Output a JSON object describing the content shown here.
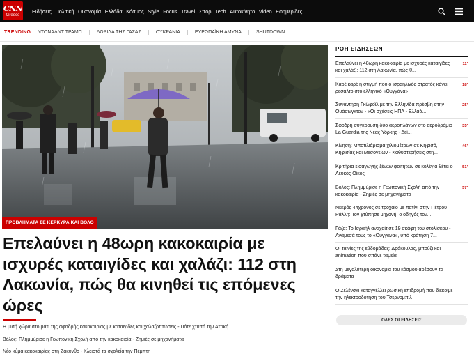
{
  "brand": {
    "logo_line1": "CNN",
    "logo_line2": "Greece",
    "accent": "#cc0000",
    "nav_bg": "#0c0c0c"
  },
  "nav": {
    "items": [
      "Ειδήσεις",
      "Πολιτική",
      "Οικονομία",
      "Ελλάδα",
      "Κόσμος",
      "Style",
      "Focus",
      "Travel",
      "Σπορ",
      "Tech",
      "Αυτοκίνητο",
      "Video",
      "Εφημερίδες"
    ],
    "icons": [
      "search-icon",
      "menu-icon"
    ]
  },
  "trending": {
    "label": "TRENDING:",
    "items": [
      "ΝΤΟΝΑΛΝΤ ΤΡΑΜΠ",
      "ΛΩΡΙΔΑ ΤΗΣ ΓΑΖΑΣ",
      "ΟΥΚΡΑΝΙΑ",
      "ΕΥΡΩΠΑΪΚΗ ΑΜΥΝΑ",
      "SHUTDOWN"
    ]
  },
  "hero": {
    "tag": "ΠΡΟΒΛΗΜΑΤΑ ΣΕ ΚΕΡΚΥΡΑ ΚΑΙ ΒΟΛΟ",
    "headline": "Επελαύνει η 48ωρη κακοκαιρία με ισχυρές καταιγίδες και χαλάζι: 112 στη Λακωνία, πώς θα κινηθεί τις επόμενες ώρες",
    "related": [
      "Η μισή χώρα στο μάτι της σφοδρής κακοκαιρίας με καταιγίδες και χαλαζοπτώσεις - Πότε χτυπά την Αττική",
      "Βόλος: Πλημμύρισε η Γεωπονική Σχολή από την κακοκαιρία - Ζημιές σε μηχανήματα",
      "Νέο κύμα κακοκαιρίας στη Ζάκυνθο - Κλειστά τα σχολεία την Πέμπτη"
    ]
  },
  "news_feed": {
    "title": "ΡΟΗ ΕΙΔΗΣΕΩΝ",
    "items": [
      {
        "text": "Επελαύνει η 48ωρη κακοκαιρία με ισχυρές καταιγίδες και χαλάζι: 112 στη Λακωνία, πώς θ...",
        "time": "11'"
      },
      {
        "text": "Καρέ καρέ η στιγμή που ο ισραηλινός στρατός κάνει ρεσάλτο στο ελληνικό «Ουγγάνα»",
        "time": "18'"
      },
      {
        "text": "Συνάντηση Γκίλφοϊλ με την Ελληνίδα πρέσβη στην Ουάσινγκτον - «Οι σχέσεις ΗΠΑ - Ελλάδ...",
        "time": "25'"
      },
      {
        "text": "Σφοδρή σύγκρουση δύο αεροπλάνων στο αεροδρόμιο La Guardia της Νέας Υόρκης - Δεί...",
        "time": "35'"
      },
      {
        "text": "Κίνηση: Μποτιλιάρισμα χιλιομέτρων σε Κηφισό, Κηφισίας και Μεσογείων - Καθυστερήσεις στη...",
        "time": "46'"
      },
      {
        "text": "Κριτήρια εισαγωγής ξένων φοιτητών σε κολέγια θέτει ο Λευκός Οίκος",
        "time": "51'"
      },
      {
        "text": "Βόλος: Πλημμύρισε η Γεωπονική Σχολή από την κακοκαιρία - Ζημιές σε μηχανήματα",
        "time": "57'"
      },
      {
        "text": "Νεκρός 44χρονος σε τροχαίο με πατίνι στην Πέτρου Ράλλη: Τον χτύπησε μηχανή, ο οδηγός τον...",
        "time": ""
      },
      {
        "text": "Γάζα: Το Ισραήλ αναχαίτισε 19 σκάφη του στολίσκου - Ανάμεσά τους το «Ουγγάνα», υπό κράτηση 7...",
        "time": ""
      },
      {
        "text": "Οι ταινίες της εβδομάδας: Δράκουλας, μπούζι και animation που σπάνε ταμεία",
        "time": ""
      },
      {
        "text": "Στη μεγαλύτερη οικονομία του κόσμου αρέσουν τα δράματα",
        "time": ""
      },
      {
        "text": "Ο Ζελένσκι καταγγέλλει ρωσική επιδρομή που διέκοψε την ηλεκτροδότηση του Τσερνομπίλ",
        "time": ""
      }
    ],
    "all_button": "ΟΛΕΣ ΟΙ ΕΙΔΗΣΕΙΣ"
  }
}
